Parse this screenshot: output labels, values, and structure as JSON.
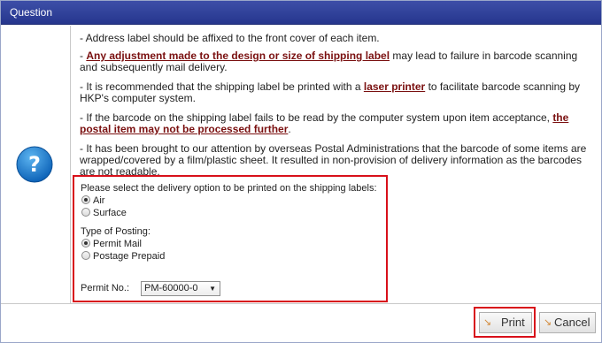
{
  "dialog": {
    "title": "Question"
  },
  "message": {
    "p1": "- Address label should be affixed to the front cover of each item.",
    "p2_dash": "- ",
    "p2_emph": "Any adjustment made to the design or size of shipping label",
    "p2_rest": " may lead to failure in barcode scanning and subsequently mail delivery.",
    "p3_pre": "- It is recommended that the shipping label be printed with a ",
    "p3_emph": "laser printer",
    "p3_rest": " to facilitate barcode scanning by HKP's computer system.",
    "p4_pre": "- If the barcode on the shipping label fails to be read by the computer system upon item acceptance, ",
    "p4_emph": "the postal item may not be processed further",
    "p4_rest": ".",
    "p5": "- It has been brought to our attention by overseas Postal Administrations that the barcode of some items are wrapped/covered by a film/plastic sheet. It resulted in non-provision of delivery information as the barcodes are not readable."
  },
  "options": {
    "delivery_label": "Please select the delivery option to be printed on the shipping labels:",
    "delivery_air": "Air",
    "delivery_surface": "Surface",
    "delivery_selected": "Air",
    "posting_label": "Type of Posting:",
    "posting_permit": "Permit Mail",
    "posting_prepaid": "Postage Prepaid",
    "posting_selected": "Permit Mail",
    "permit_label": "Permit No.:",
    "permit_value": "PM-60000-0"
  },
  "buttons": {
    "print": "Print",
    "cancel": "Cancel"
  },
  "colors": {
    "titlebar": "#26368d",
    "emphasis": "#7a1010",
    "highlight_border": "#d8101a"
  }
}
